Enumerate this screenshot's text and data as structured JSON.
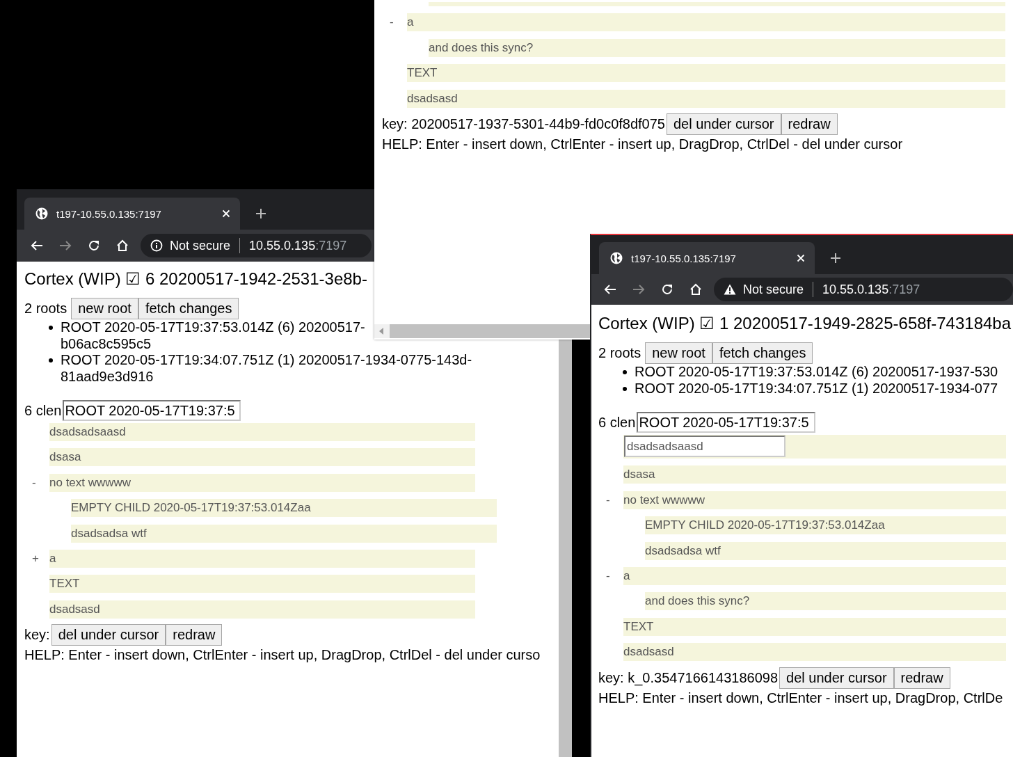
{
  "windows": [
    {
      "tab": {
        "title": "t197-10.55.0.135:7197"
      },
      "address": {
        "kind": "info",
        "security": "Not secure",
        "host": "10.55.0.135",
        "port": ":7197"
      },
      "heading": "Cortex (WIP) ☑ 6 20200517-1942-2531-3e8b-",
      "roots_count": "2 roots",
      "root_buttons": [
        "new root",
        "fetch changes"
      ],
      "roots": [
        {
          "lines": [
            "ROOT 2020-05-17T19:37:53.014Z (6) 20200517-",
            "b06ac8c595c5"
          ]
        },
        {
          "lines": [
            "ROOT 2020-05-17T19:34:07.751Z (1) 20200517-1934-0775-143d-",
            "81aad9e3d916"
          ]
        }
      ],
      "editor": {
        "label": "6 clen",
        "value": "ROOT 2020-05-17T19:37:5"
      },
      "tree": [
        {
          "kind": "row",
          "text": "dsadsadsaasd"
        },
        {
          "kind": "row",
          "text": "dsasa"
        },
        {
          "kind": "row",
          "toggle": "-",
          "text": "no text wwwww",
          "children": [
            {
              "kind": "row",
              "text": "EMPTY CHILD 2020-05-17T19:37:53.014Zaa"
            },
            {
              "kind": "row",
              "text": "dsadsadsa wtf"
            }
          ]
        },
        {
          "kind": "row",
          "toggle": "+",
          "text": "a"
        },
        {
          "kind": "row",
          "text": "TEXT"
        },
        {
          "kind": "row",
          "text": "dsadsasd"
        }
      ],
      "key": "key:",
      "key_buttons": [
        "del under cursor",
        "redraw"
      ],
      "help": "HELP: Enter - insert down, CtrlEnter - insert up, DragDrop, CtrlDel - del under curso"
    },
    {
      "tree": [
        {
          "kind": "tail",
          "children": [
            {
              "kind": "tail"
            }
          ]
        },
        {
          "kind": "row",
          "toggle": "-",
          "text": "a",
          "children": [
            {
              "kind": "row",
              "text": "and does this sync?"
            }
          ]
        },
        {
          "kind": "row",
          "text": "TEXT"
        },
        {
          "kind": "row",
          "text": "dsadsasd"
        }
      ],
      "key": "key: 20200517-1937-5301-44b9-fd0c0f8df075",
      "key_buttons": [
        "del under cursor",
        "redraw"
      ],
      "help": "HELP: Enter - insert down, CtrlEnter - insert up, DragDrop, CtrlDel - del under cursor"
    },
    {
      "tab": {
        "title": "t197-10.55.0.135:7197"
      },
      "address": {
        "kind": "warning",
        "security": "Not secure",
        "host": "10.55.0.135",
        "port": ":7197"
      },
      "heading": "Cortex (WIP) ☑ 1 20200517-1949-2825-658f-743184ba",
      "roots_count": "2 roots",
      "root_buttons": [
        "new root",
        "fetch changes"
      ],
      "roots": [
        {
          "lines": [
            "ROOT 2020-05-17T19:37:53.014Z (6) 20200517-1937-530"
          ]
        },
        {
          "lines": [
            "ROOT 2020-05-17T19:34:07.751Z (1) 20200517-1934-077"
          ]
        }
      ],
      "editor": {
        "label": "6 clen",
        "value": "ROOT 2020-05-17T19:37:5"
      },
      "tree": [
        {
          "kind": "editing",
          "text": "dsadsadsaasd"
        },
        {
          "kind": "row",
          "text": "dsasa"
        },
        {
          "kind": "row",
          "toggle": "-",
          "text": "no text wwwww",
          "children": [
            {
              "kind": "row",
              "text": "EMPTY CHILD 2020-05-17T19:37:53.014Zaa"
            },
            {
              "kind": "row",
              "text": "dsadsadsa wtf"
            }
          ]
        },
        {
          "kind": "row",
          "toggle": "-",
          "text": "a",
          "children": [
            {
              "kind": "row",
              "text": "and does this sync?"
            }
          ]
        },
        {
          "kind": "row",
          "text": "TEXT"
        },
        {
          "kind": "row",
          "text": "dsadsasd"
        }
      ],
      "key": "key: k_0.3547166143186098",
      "key_buttons": [
        "del under cursor",
        "redraw"
      ],
      "help": "HELP: Enter - insert down, CtrlEnter - insert up, DragDrop, CtrlDe"
    }
  ]
}
